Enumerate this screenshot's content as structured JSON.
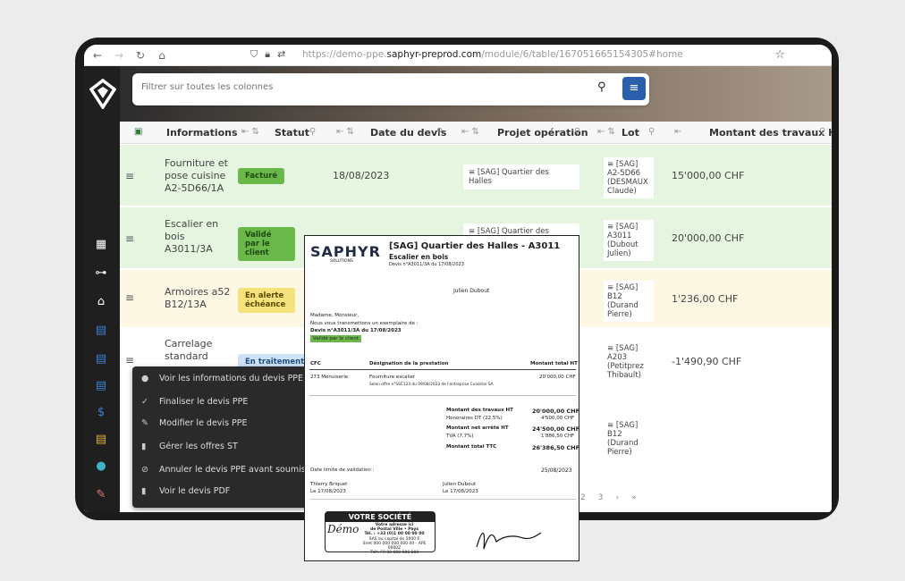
{
  "browser": {
    "url_prefix": "https://demo-ppe.",
    "url_host": "saphyr-preprod.com",
    "url_path": "/module/6/table/1670516651543​05#home"
  },
  "filter": {
    "placeholder": "Filtrer sur toutes les colonnes"
  },
  "columns": [
    "Informations",
    "Statut",
    "Date du devis",
    "Projet opération",
    "Lot",
    "Montant des travaux HT"
  ],
  "rows": [
    {
      "info": [
        "Fourniture et",
        "pose cuisine",
        "A2-5D66/1A"
      ],
      "status": "Facturé",
      "date": "18/08/2023",
      "project": "≡ [SAG] Quartier des Halles",
      "lot": [
        "≡ [SAG]",
        "A2-5D66",
        "(DESMAUX",
        "Claude)"
      ],
      "amount": "15'000,00 CHF"
    },
    {
      "info": [
        "Escalier en",
        "bois",
        "A3011/3A"
      ],
      "status": "Validé par le client",
      "date": "",
      "project": "≡ [SAG] Quartier des",
      "lot": [
        "≡ [SAG]",
        "A3011",
        "(Dubout",
        "Julien)"
      ],
      "amount": "20'000,00 CHF"
    },
    {
      "info": [
        "Armoires a52",
        "B12/13A"
      ],
      "status": "En alerte échéance",
      "date": "",
      "project": "",
      "lot": [
        "≡ [SAG]",
        "B12",
        "(Durand",
        "Pierre)"
      ],
      "amount": "1'236,00 CHF"
    },
    {
      "info": [
        "Carrelage",
        "standard"
      ],
      "status": "En traitement",
      "date": "",
      "project": "",
      "lot": [
        "≡ [SAG]",
        "A203",
        "(Petitprez",
        "Thibault)"
      ],
      "amount": "-1'490,90 CHF"
    },
    {
      "info": [],
      "status": "",
      "date": "",
      "project": "",
      "lot": [
        "≡ [SAG]",
        "B12",
        "(Durand",
        "Pierre)"
      ],
      "amount": ""
    }
  ],
  "context_menu": [
    {
      "icon": "eye-icon",
      "glyph": "●",
      "label": "Voir les informations du devis PPE"
    },
    {
      "icon": "check-icon",
      "glyph": "✓",
      "label": "Finaliser le devis PPE"
    },
    {
      "icon": "pencil-icon",
      "glyph": "✎",
      "label": "Modifier le devis PPE"
    },
    {
      "icon": "file-icon",
      "glyph": "▮",
      "label": "Gérer les offres ST"
    },
    {
      "icon": "cancel-icon",
      "glyph": "⊘",
      "label": "Annuler le devis PPE avant soumission au"
    },
    {
      "icon": "file-icon",
      "glyph": "▮",
      "label": "Voir le devis PDF"
    }
  ],
  "pager": [
    "2",
    "3",
    "›",
    "»"
  ],
  "document": {
    "brand": "SAPHYR",
    "brand_sub": "SOLUTIONS",
    "title": "[SAG] Quartier des Halles - A3011",
    "subtitle": "Escalier en bois",
    "ref": "Devis n°A3011/3A du 17/08/2023",
    "recipient": "Julien Dubout",
    "greeting": "Madame, Monsieur,",
    "intro": "Nous vous transmettons un exemplaire de :",
    "quote": "Devis n°A3011/3A du 17/08/2023",
    "status": "Validé par le client",
    "col_cfc": "CFC",
    "col_design": "Désignation de la prestation",
    "col_total": "Montant total HT",
    "line_cfc": "273 Menuiserie",
    "line_item": "Fourniture escalier",
    "line_note": "Selon offre n°SSC123 du 09/08/2023 de l'entreprise Cuisistar SA",
    "line_amount": "20'000,00 CHF",
    "totals": [
      {
        "label": "Montant des travaux HT",
        "value": "20'000,00 CHF",
        "bold": true
      },
      {
        "label": "Honoraires DT (22.5%)",
        "value": "4'500,00 CHF",
        "bold": false
      },
      {
        "label": "Montant net arrêté HT",
        "value": "24'500,00 CHF",
        "bold": true
      },
      {
        "label": "TVA (7.7%)",
        "value": "1'886,50 CHF",
        "bold": false
      },
      {
        "label": "Montant total TTC",
        "value": "26'386,50 CHF",
        "bold": true
      }
    ],
    "deadline_label": "Date limite de validation :",
    "deadline": "25/08/2023",
    "sign_left_name": "Thierry Briquet",
    "sign_left_date": "Le 17/08/2023",
    "sign_right_name": "Julien Dubout",
    "sign_right_date": "Le 17/08/2023",
    "stamp_title": "VOTRE SOCIÉTÉ",
    "stamp_lines": [
      "Votre adresse ici",
      "de Postal Ville • Pays",
      "Tél. : +33 (0)1 00 00 00 00",
      "SAS au capital de 5000 €",
      "Siret 000 000 000 000 00 - APE 0000Z",
      "TVA: FR 00 000 000 000"
    ],
    "stamp_signature": "Démo"
  },
  "colors": {
    "green_row": "#e6f5e0",
    "yellow_row": "#fdf8e4",
    "badge_green": "#6bb84a",
    "badge_yellow": "#f6e27a",
    "badge_blue": "#cfe3f7",
    "accent": "#2b5fad"
  }
}
